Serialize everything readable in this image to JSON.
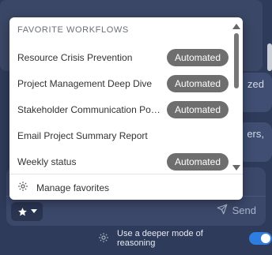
{
  "background": {
    "bubble1_text": "zed",
    "bubble2_text": "ers,"
  },
  "dropdown": {
    "header": "FAVORITE WORKFLOWS",
    "items": [
      {
        "label": "Resource Crisis Prevention",
        "badge": "Automated"
      },
      {
        "label": "Project Management Deep Dive",
        "badge": "Automated"
      },
      {
        "label": "Stakeholder Communication Power...",
        "badge": "Automated"
      },
      {
        "label": "Email Project Summary Report",
        "badge": ""
      },
      {
        "label": "Weekly status",
        "badge": "Automated"
      }
    ],
    "manage_label": "Manage favorites"
  },
  "composer": {
    "send_label": "Send"
  },
  "reasoning": {
    "label": "Use a deeper mode of reasoning",
    "enabled": true
  },
  "colors": {
    "accent": "#2f7de1",
    "badge": "#6e6e6e",
    "background": "#2f3b5a"
  }
}
